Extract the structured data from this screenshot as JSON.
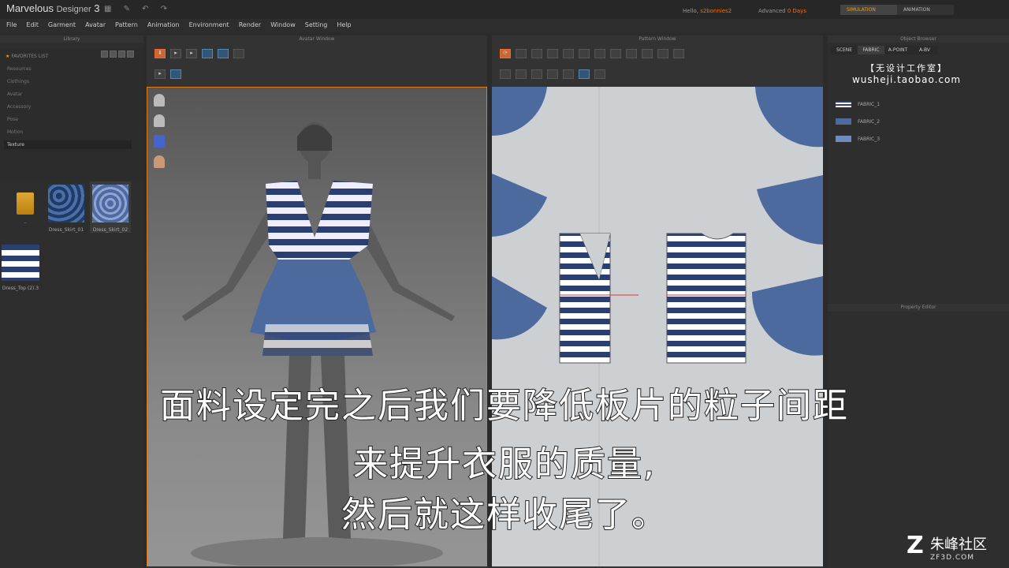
{
  "app": {
    "name": "Marvelous",
    "name_sub": "Designer",
    "version": "3"
  },
  "header": {
    "hello_label": "Hello,",
    "user": "s2bonnies2",
    "license_label": "Advanced",
    "days": "0 Days"
  },
  "modes": [
    {
      "label": "SIMULATION",
      "active": true
    },
    {
      "label": "ANIMATION",
      "active": false
    }
  ],
  "menu": [
    "File",
    "Edit",
    "Garment",
    "Avatar",
    "Pattern",
    "Animation",
    "Environment",
    "Render",
    "Window",
    "Setting",
    "Help"
  ],
  "panels": {
    "library": "Library",
    "avatar": "Avatar Window",
    "pattern": "Pattern Window",
    "object_browser": "Object Browser",
    "property": "Property Editor"
  },
  "library": {
    "favorites": "FAVORITES LIST",
    "items": [
      "Resources",
      "Clothings",
      "Avatar",
      "Accessory",
      "Pose",
      "Motion",
      "Texture"
    ],
    "selected": "Texture",
    "thumbs": [
      {
        "label": "..",
        "kind": "folder"
      },
      {
        "label": "Dress_Skirt_01",
        "kind": "floral"
      },
      {
        "label": "Dress_Skirt_02",
        "kind": "floral"
      },
      {
        "label": "Dress_Top (2).3",
        "kind": "stripes"
      }
    ]
  },
  "object_browser": {
    "tabs": [
      "SCENE",
      "FABRIC",
      "A-POINT",
      "A-BV"
    ],
    "active_tab": "FABRIC",
    "fabrics": [
      "FABRIC_1",
      "FABRIC_2",
      "FABRIC_3"
    ]
  },
  "watermark": {
    "cn": "【无设计工作室】",
    "url": "wusheji.taobao.com"
  },
  "subtitles": [
    "面料设定完之后我们要降低板片的粒子间距",
    "来提升衣服的质量,",
    "然后就这样收尾了。"
  ],
  "brand": {
    "name": "朱峰社区",
    "url": "ZF3D.COM"
  },
  "colors": {
    "accent": "#e07a1c",
    "navy": "#2a3f6f",
    "skirt_blue": "#4d6a9e"
  }
}
